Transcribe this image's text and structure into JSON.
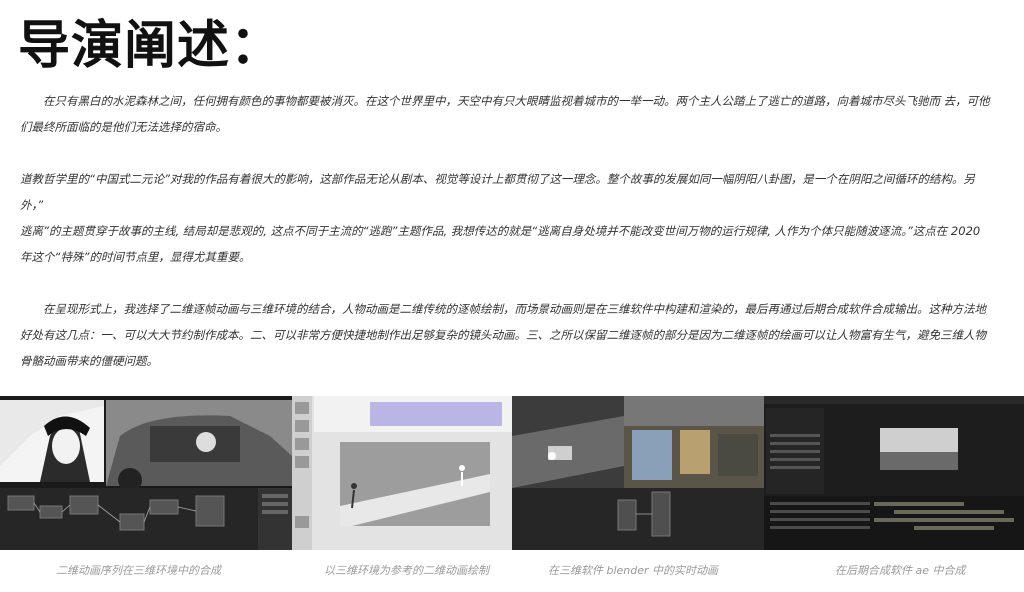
{
  "heading": "导演阐述：",
  "paragraphs": [
    "　　在只有黑白的水泥森林之间，任何拥有颜色的事物都要被消灭。在这个世界里中，天空中有只大眼睛监视着城市的一举一动。两个主人公踏上了逃亡的道路，向着城市尽头飞驰而 去，可他们最终所面临的是他们无法选择的宿命。",
    "道教哲学里的“中国式二元论”对我的作品有着很大的影响，这部作品无论从剧本、视觉等设计上都贯彻了这一理念。整个故事的发展如同一幅阴阳八卦图，是一个在阴阳之间循环的结构。另外，”",
    "逃离”的主题贯穿于故事的主线, 结局却是悲观的, 这点不同于主流的“逃跑”主题作品, 我想传达的就是“逃离自身处境并不能改变世间万物的运行规律, 人作为个体只能随波逐流。”这点在 2020 年这个“特殊”的时间节点里，显得尤其重要。",
    "　　在呈现形式上，我选择了二维逐帧动画与三维环境的结合，人物动画是二维传统的逐帧绘制，而场景动画则是在三维软件中构建和渲染的，最后再通过后期合成软件合成输出。这种方法地好处有这几点：一、可以大大节约制作成本。二、可以非常方便快捷地制作出足够复杂的镜头动画。三、之所以保留二维逐帧的部分是因为二维逐帧的绘画可以让人物富有生气，避免三维人物骨骼动画带来的僵硬问题。"
  ],
  "captions": [
    "二维动画序列在三维环境中的合成",
    "以三维环境为参考的二维动画绘制",
    "在三维软件 blender 中的实时动画",
    "在后期合成软件 ae 中合成"
  ],
  "colors": {
    "title": "#111111",
    "body_text": "#333333",
    "caption": "#9a9a9a",
    "panel_dark": "#222222",
    "timeline_blue": "#b9b6e6"
  }
}
